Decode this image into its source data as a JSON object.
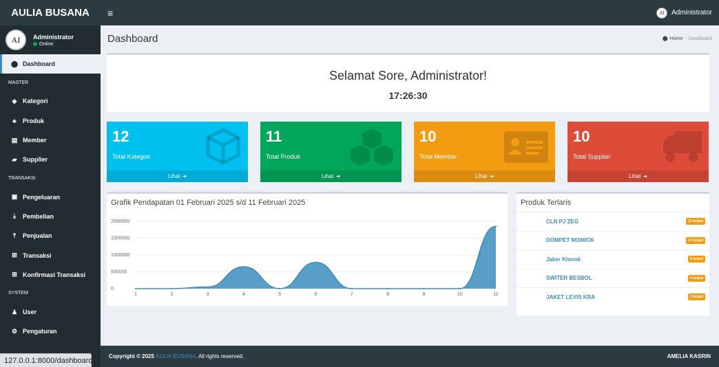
{
  "app": {
    "brand": "AULIA BUSANA",
    "menu_toggle": "≡",
    "top_user": "Administrator",
    "avatar_text": "AI"
  },
  "user_panel": {
    "name": "Administrator",
    "status": "Online"
  },
  "sidebar": {
    "items": [
      {
        "label": "Dashboard",
        "icon": "dashboard-icon",
        "glyph": "⬤",
        "active": true
      },
      {
        "header": "MASTER"
      },
      {
        "label": "Kategori",
        "icon": "tag-icon",
        "glyph": "◈"
      },
      {
        "label": "Produk",
        "icon": "cubes-icon",
        "glyph": "♣"
      },
      {
        "label": "Member",
        "icon": "id-card-icon",
        "glyph": "▤"
      },
      {
        "label": "Supplier",
        "icon": "truck-icon",
        "glyph": "▰"
      },
      {
        "header": "TRANSAKSI"
      },
      {
        "label": "Pengeluaran",
        "icon": "money-icon",
        "glyph": "▣"
      },
      {
        "label": "Pembelian",
        "icon": "download-icon",
        "glyph": "⤓"
      },
      {
        "label": "Penjualan",
        "icon": "upload-icon",
        "glyph": "⤒"
      },
      {
        "label": "Transaksi",
        "icon": "cart-icon",
        "glyph": "⊞"
      },
      {
        "label": "Konfirmasi Transaksi",
        "icon": "cart-icon",
        "glyph": "⊞"
      },
      {
        "header": "SYSTEM"
      },
      {
        "label": "User",
        "icon": "users-icon",
        "glyph": "♟"
      },
      {
        "label": "Pengaturan",
        "icon": "cogs-icon",
        "glyph": "⚙"
      }
    ]
  },
  "header": {
    "title": "Dashboard",
    "breadcrumb_home": "Home",
    "breadcrumb_current": "Dashboard"
  },
  "welcome": {
    "greeting": "Selamat Sore, Administrator!",
    "time": "17:26:30"
  },
  "stat_boxes": [
    {
      "value": "12",
      "label": "Total Kategori",
      "link": "Lihat",
      "color": "#00c0ef",
      "icon": "cube-icon"
    },
    {
      "value": "11",
      "label": "Total Produk",
      "link": "Lihat",
      "color": "#00a65a",
      "icon": "cubes-icon"
    },
    {
      "value": "10",
      "label": "Total Member",
      "link": "Lihat",
      "color": "#f39c12",
      "icon": "id-card-icon"
    },
    {
      "value": "10",
      "label": "Total Supplier",
      "link": "Lihat",
      "color": "#dd4b39",
      "icon": "truck-icon"
    }
  ],
  "chart_data": {
    "type": "area",
    "title": "Grafik Pendapatan 01 Februari 2025 s/d 11 Februari 2025",
    "x": [
      1,
      2,
      3,
      4,
      5,
      6,
      7,
      8,
      9,
      10,
      11
    ],
    "series": [
      {
        "values": [
          0,
          0,
          50000,
          650000,
          0,
          780000,
          0,
          0,
          0,
          0,
          1850000
        ]
      }
    ],
    "y_ticks": [
      "2000000",
      "1500000",
      "1000000",
      "500000",
      "0"
    ],
    "ylim": [
      0,
      2000000
    ],
    "color": "#3c8dbc",
    "grid": true
  },
  "best_sellers": {
    "title": "Produk Terlaris",
    "items": [
      {
        "name": "CLN PJ ZEG",
        "badge": "23 terjual"
      },
      {
        "name": "DOMPET MOMICK",
        "badge": "11 terjual"
      },
      {
        "name": "Jaker Klonnk",
        "badge": "6 terjual"
      },
      {
        "name": "SWITER BESBOL",
        "badge": "4 terjual"
      },
      {
        "name": "JAKET LEVIS KRA",
        "badge": "3 terjual"
      }
    ]
  },
  "footer": {
    "copyright_prefix": "Copyright © 2025 ",
    "brand": "AULIA BUSANA",
    "suffix": ". All rights reserved.",
    "right": "AMELIA KASRIN"
  },
  "status_url": "127.0.0.1:8000/dashboard"
}
